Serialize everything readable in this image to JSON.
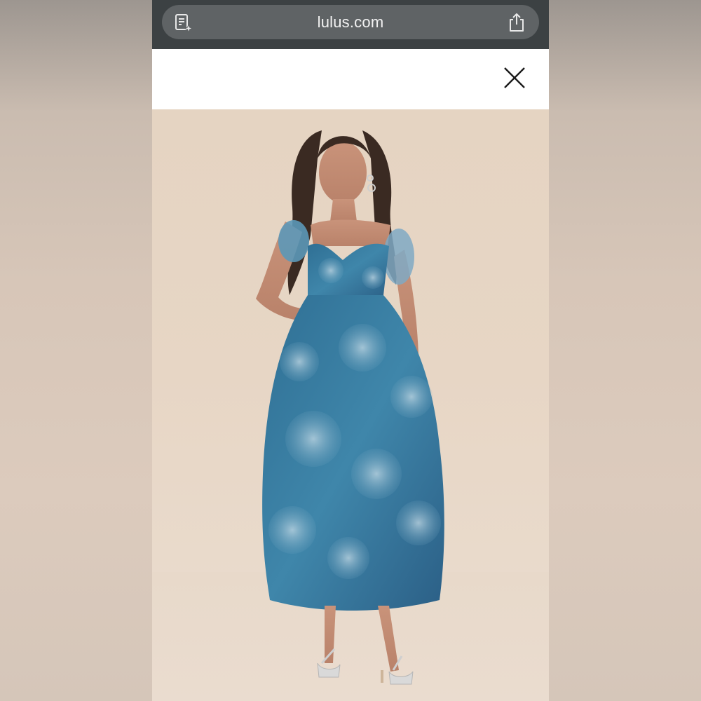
{
  "browser": {
    "url": "lulus.com",
    "reader_icon": "reader-mode-icon",
    "share_icon": "share-icon",
    "bar_color": "#3c4143",
    "pill_color": "#5f6365"
  },
  "header": {
    "close_icon": "close-icon"
  },
  "product_image": {
    "subject": "model-in-floral-dress",
    "dress_colors": [
      "#2f6f94",
      "#4a93b5",
      "#a9c7d8"
    ],
    "background_color": "#e6d5c4"
  }
}
